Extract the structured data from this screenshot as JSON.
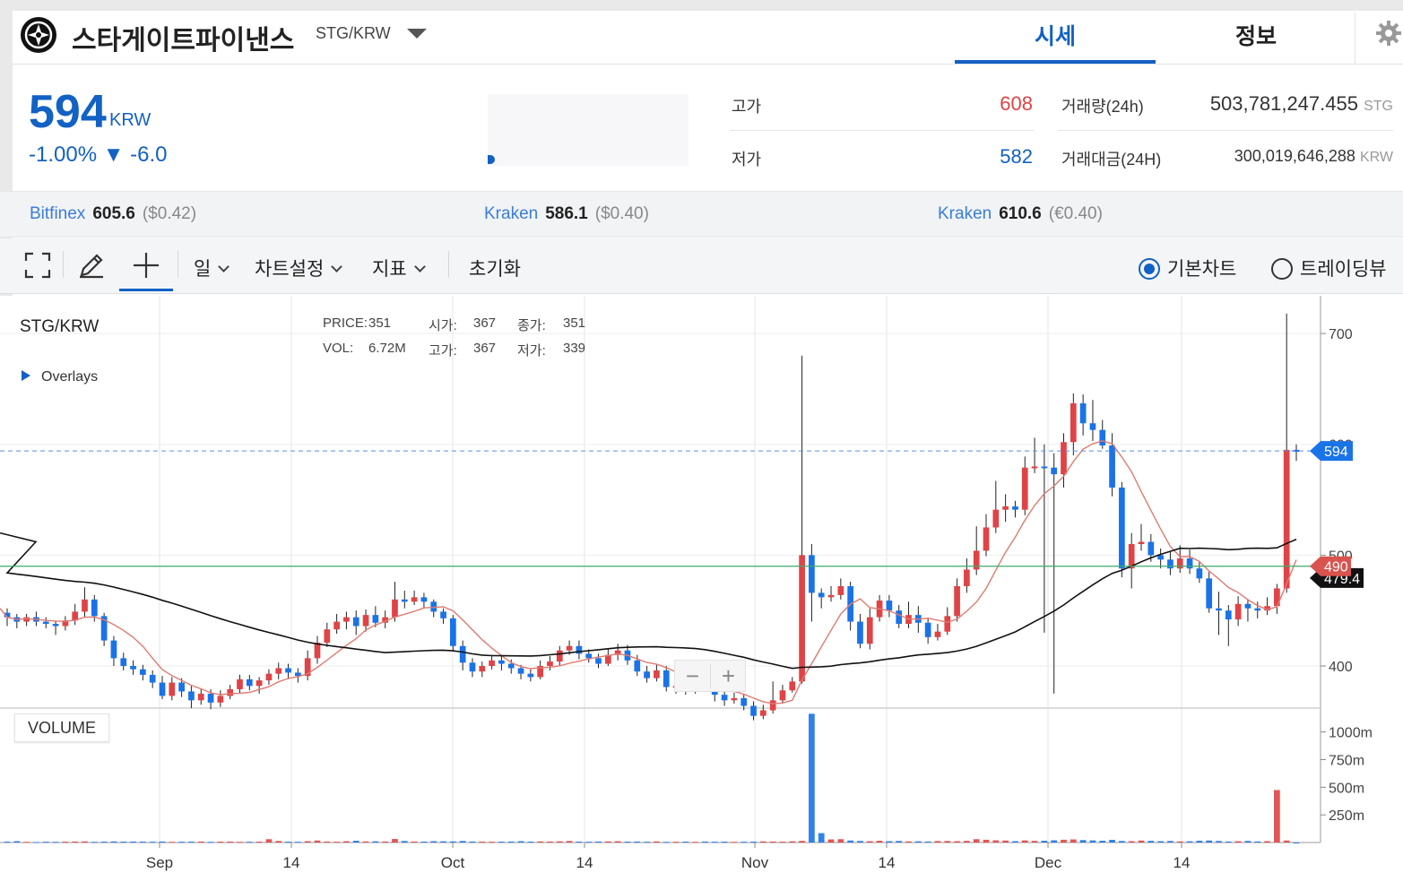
{
  "header": {
    "coin_name": "스타게이트파이낸스",
    "pair": "STG/KRW",
    "tabs": [
      {
        "label": "시세",
        "active": true
      },
      {
        "label": "정보",
        "active": false
      }
    ]
  },
  "price": {
    "current": "594",
    "unit": "KRW",
    "change": "-1.00% ▼ -6.0",
    "color": "#1261c4"
  },
  "stats": {
    "high_label": "고가",
    "high_value": "608",
    "low_label": "저가",
    "low_value": "582",
    "volume_label": "거래량(24h)",
    "volume_value": "503,781,247.455",
    "volume_unit": "STG",
    "amount_label": "거래대금(24H)",
    "amount_value": "300,019,646,288",
    "amount_unit": "KRW"
  },
  "exchanges": [
    {
      "name": "Bitfinex",
      "price": "605.6",
      "usd": "($0.42)"
    },
    {
      "name": "Kraken",
      "price": "586.1",
      "usd": "($0.40)"
    },
    {
      "name": "Kraken",
      "price": "610.6",
      "usd": "(€0.40)"
    }
  ],
  "toolbar": {
    "interval": "일",
    "chart_settings": "차트설정",
    "indicators": "지표",
    "reset": "초기화",
    "basic_chart": "기본차트",
    "tradingview": "트레이딩뷰"
  },
  "chart_info": {
    "symbol": "STG/KRW",
    "price_label": "PRICE:",
    "price_value": "351",
    "open_label": "시가:",
    "open_value": "367",
    "close_label": "종가:",
    "close_value": "351",
    "vol_label": "VOL:",
    "vol_value": "6.72M",
    "high_label": "고가:",
    "high_value": "367",
    "low_label": "저가:",
    "low_value": "339",
    "overlays": "Overlays",
    "volume_title": "VOLUME",
    "zoom_out": "−",
    "zoom_in": "+"
  },
  "chart_data": {
    "type": "candlestick",
    "x_ticks": [
      "Sep",
      "14",
      "Oct",
      "14",
      "Nov",
      "14",
      "Dec",
      "14"
    ],
    "y_ticks": [
      "400",
      "500",
      "600",
      "700"
    ],
    "ylim": [
      362,
      730
    ],
    "volume_ticks": [
      "250m",
      "500m",
      "750m",
      "1000m"
    ],
    "volume_lim": [
      0,
      1200
    ],
    "last_price": 594,
    "ma_value": 490,
    "ma_long_value": "479.4",
    "colors": {
      "up": "#e04346",
      "down": "#1a73e8",
      "ma_short": "#e07a70",
      "ma_long": "#111111",
      "hline": "#3caa6e"
    },
    "candles": [
      [
        448,
        444,
        452,
        436
      ],
      [
        444,
        440,
        447,
        434
      ],
      [
        440,
        444,
        447,
        436
      ],
      [
        444,
        440,
        449,
        436
      ],
      [
        440,
        438,
        444,
        434
      ],
      [
        438,
        436,
        441,
        428
      ],
      [
        436,
        441,
        445,
        432
      ],
      [
        441,
        449,
        456,
        437
      ],
      [
        449,
        460,
        471,
        444
      ],
      [
        460,
        445,
        464,
        440
      ],
      [
        445,
        423,
        448,
        418
      ],
      [
        423,
        407,
        427,
        400
      ],
      [
        407,
        400,
        412,
        396
      ],
      [
        400,
        397,
        405,
        392
      ],
      [
        397,
        392,
        401,
        387
      ],
      [
        392,
        385,
        396,
        380
      ],
      [
        385,
        373,
        391,
        370
      ],
      [
        373,
        385,
        390,
        369
      ],
      [
        385,
        377,
        389,
        372
      ],
      [
        377,
        369,
        382,
        362
      ],
      [
        369,
        375,
        379,
        365
      ],
      [
        375,
        367,
        379,
        361
      ],
      [
        367,
        373,
        378,
        363
      ],
      [
        373,
        379,
        383,
        370
      ],
      [
        379,
        388,
        392,
        375
      ],
      [
        388,
        382,
        392,
        378
      ],
      [
        382,
        387,
        390,
        375
      ],
      [
        387,
        393,
        397,
        383
      ],
      [
        393,
        398,
        403,
        388
      ],
      [
        398,
        394,
        402,
        388
      ],
      [
        394,
        391,
        398,
        385
      ],
      [
        391,
        407,
        414,
        387
      ],
      [
        407,
        421,
        427,
        402
      ],
      [
        421,
        433,
        439,
        417
      ],
      [
        433,
        440,
        447,
        429
      ],
      [
        440,
        444,
        449,
        433
      ],
      [
        444,
        436,
        450,
        428
      ],
      [
        436,
        446,
        451,
        431
      ],
      [
        446,
        439,
        454,
        435
      ],
      [
        439,
        444,
        450,
        434
      ],
      [
        444,
        460,
        476,
        440
      ],
      [
        460,
        458,
        468,
        452
      ],
      [
        458,
        462,
        468,
        455
      ],
      [
        462,
        458,
        466,
        452
      ],
      [
        458,
        449,
        460,
        444
      ],
      [
        449,
        443,
        452,
        438
      ],
      [
        443,
        418,
        446,
        414
      ],
      [
        418,
        403,
        423,
        396
      ],
      [
        403,
        395,
        407,
        390
      ],
      [
        395,
        400,
        404,
        390
      ],
      [
        400,
        405,
        410,
        397
      ],
      [
        405,
        402,
        410,
        396
      ],
      [
        402,
        398,
        406,
        393
      ],
      [
        398,
        393,
        401,
        388
      ],
      [
        393,
        390,
        397,
        386
      ],
      [
        390,
        400,
        405,
        388
      ],
      [
        400,
        404,
        409,
        396
      ],
      [
        404,
        414,
        418,
        400
      ],
      [
        414,
        418,
        423,
        410
      ],
      [
        418,
        411,
        423,
        406
      ],
      [
        411,
        407,
        415,
        403
      ],
      [
        407,
        402,
        411,
        398
      ],
      [
        402,
        410,
        416,
        400
      ],
      [
        410,
        414,
        420,
        405
      ],
      [
        414,
        405,
        419,
        401
      ],
      [
        405,
        395,
        410,
        391
      ],
      [
        395,
        389,
        400,
        385
      ],
      [
        389,
        396,
        401,
        386
      ],
      [
        396,
        381,
        400,
        377
      ],
      [
        381,
        382,
        385,
        375
      ],
      [
        382,
        380,
        387,
        374
      ],
      [
        380,
        383,
        386,
        375
      ],
      [
        383,
        381,
        388,
        377
      ],
      [
        381,
        374,
        392,
        368
      ],
      [
        374,
        369,
        378,
        364
      ],
      [
        369,
        371,
        376,
        366
      ],
      [
        371,
        364,
        374,
        360
      ],
      [
        364,
        355,
        368,
        351
      ],
      [
        355,
        360,
        365,
        352
      ],
      [
        360,
        369,
        386,
        357
      ],
      [
        369,
        378,
        383,
        366
      ],
      [
        378,
        386,
        390,
        376
      ],
      [
        386,
        500,
        680,
        384
      ],
      [
        500,
        466,
        510,
        440
      ],
      [
        466,
        462,
        470,
        452
      ],
      [
        462,
        464,
        472,
        458
      ],
      [
        464,
        472,
        479,
        460
      ],
      [
        472,
        440,
        476,
        432
      ],
      [
        440,
        420,
        447,
        416
      ],
      [
        420,
        444,
        452,
        415
      ],
      [
        444,
        459,
        464,
        440
      ],
      [
        459,
        450,
        464,
        444
      ],
      [
        450,
        438,
        455,
        434
      ],
      [
        438,
        446,
        458,
        434
      ],
      [
        446,
        439,
        454,
        430
      ],
      [
        439,
        426,
        443,
        420
      ],
      [
        426,
        431,
        438,
        423
      ],
      [
        431,
        445,
        453,
        428
      ],
      [
        445,
        472,
        479,
        440
      ],
      [
        472,
        487,
        497,
        466
      ],
      [
        487,
        504,
        526,
        482
      ],
      [
        504,
        525,
        537,
        499
      ],
      [
        525,
        541,
        567,
        520
      ],
      [
        541,
        544,
        555,
        530
      ],
      [
        544,
        541,
        549,
        534
      ],
      [
        541,
        579,
        589,
        536
      ],
      [
        579,
        580,
        606,
        574
      ],
      [
        580,
        579,
        600,
        430
      ],
      [
        579,
        573,
        592,
        375
      ],
      [
        573,
        602,
        610,
        561
      ],
      [
        602,
        637,
        646,
        590
      ],
      [
        637,
        619,
        645,
        608
      ],
      [
        619,
        613,
        640,
        603
      ],
      [
        613,
        599,
        622,
        596
      ],
      [
        599,
        561,
        610,
        553
      ],
      [
        561,
        488,
        566,
        480
      ],
      [
        488,
        510,
        520,
        470
      ],
      [
        510,
        512,
        528,
        504
      ],
      [
        512,
        500,
        519,
        494
      ],
      [
        500,
        496,
        506,
        488
      ],
      [
        496,
        488,
        503,
        482
      ],
      [
        488,
        497,
        509,
        484
      ],
      [
        497,
        488,
        505,
        483
      ],
      [
        488,
        479,
        495,
        475
      ],
      [
        479,
        452,
        485,
        448
      ],
      [
        452,
        450,
        467,
        428
      ],
      [
        450,
        442,
        455,
        418
      ],
      [
        442,
        456,
        463,
        436
      ],
      [
        456,
        452,
        460,
        440
      ],
      [
        452,
        450,
        458,
        443
      ],
      [
        450,
        454,
        462,
        446
      ],
      [
        454,
        470,
        474,
        447
      ],
      [
        470,
        595,
        718,
        466
      ],
      [
        595,
        594,
        600,
        585
      ]
    ],
    "volumes": [
      8,
      12,
      6,
      4,
      7,
      6,
      8,
      9,
      10,
      6,
      8,
      10,
      8,
      9,
      8,
      7,
      9,
      6,
      7,
      8,
      9,
      6,
      8,
      9,
      6,
      7,
      8,
      30,
      14,
      8,
      7,
      12,
      18,
      9,
      7,
      12,
      16,
      10,
      11,
      9,
      32,
      14,
      9,
      8,
      12,
      11,
      10,
      14,
      9,
      8,
      7,
      8,
      9,
      12,
      8,
      10,
      9,
      11,
      14,
      8,
      7,
      9,
      10,
      12,
      8,
      9,
      7,
      10,
      6,
      7,
      8,
      6,
      9,
      7,
      8,
      6,
      7,
      8,
      10,
      9,
      8,
      11,
      15,
      1165,
      85,
      28,
      30,
      18,
      14,
      12,
      16,
      12,
      14,
      10,
      11,
      9,
      13,
      14,
      12,
      15,
      30,
      25,
      20,
      18,
      12,
      19,
      15,
      16,
      20,
      25,
      28,
      22,
      19,
      16,
      24,
      14,
      12,
      18,
      15,
      12,
      14,
      10,
      11,
      16,
      18,
      14,
      9,
      12,
      14,
      10,
      12,
      475,
      18
    ]
  }
}
